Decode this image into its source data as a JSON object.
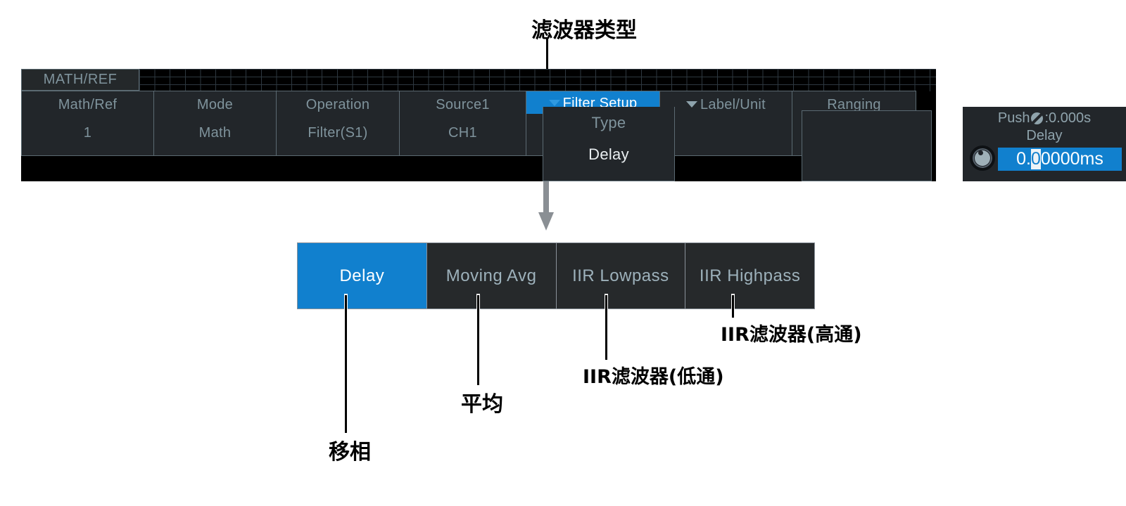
{
  "annotations": {
    "title_top": "滤波器类型",
    "labels": [
      {
        "text": "移相",
        "for": "Delay"
      },
      {
        "text": "平均",
        "for": "Moving Avg"
      },
      {
        "text": "IIR滤波器(低通)",
        "for": "IIR Lowpass"
      },
      {
        "text": "IIR滤波器(高通)",
        "for": "IIR Highpass"
      }
    ]
  },
  "scope": {
    "screen_title": "MATH/REF",
    "menu_columns": [
      {
        "header": "Math/Ref",
        "value": "1",
        "selected": false
      },
      {
        "header": "Mode",
        "value": "Math",
        "selected": false
      },
      {
        "header": "Operation",
        "value": "Filter(S1)",
        "selected": false
      },
      {
        "header": "Source1",
        "value": "CH1",
        "selected": false
      },
      {
        "header": "Filter Setup",
        "value": "",
        "selected": true
      },
      {
        "header": "Label/Unit",
        "value": "",
        "selected": false
      },
      {
        "header": "Ranging",
        "value": "",
        "selected": false
      }
    ],
    "dropdown": {
      "items": [
        {
          "label": "Type",
          "state": "dim"
        },
        {
          "label": "Delay",
          "state": "bright"
        }
      ]
    },
    "readout": {
      "push_prefix": "Push",
      "push_icon": "slash-circle-icon",
      "push_value": ":0.000s",
      "parameter": "Delay",
      "value_before_cursor": "0.",
      "value_cursor": "0",
      "value_after_cursor": "0000ms",
      "full_value": "0.00000ms"
    }
  },
  "options": {
    "items": [
      {
        "label": "Delay",
        "active": true
      },
      {
        "label": "Moving Avg",
        "active": false
      },
      {
        "label": "IIR Lowpass",
        "active": false
      },
      {
        "label": "IIR Highpass",
        "active": false
      }
    ]
  },
  "colors": {
    "accent_blue": "#1180ce",
    "panel_bg": "#22262a",
    "screen_bg": "#000000",
    "border": "#5b6a72",
    "text_dim": "#7f939c",
    "text_bright": "#ffffff",
    "arrow_gray": "#8a8f94"
  }
}
